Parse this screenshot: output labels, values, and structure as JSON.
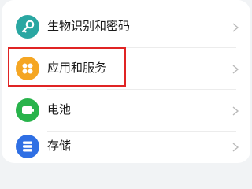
{
  "settings": {
    "items": [
      {
        "label": "生物识别和密码",
        "icon": "key-icon",
        "color": "#2aa7a2"
      },
      {
        "label": "应用和服务",
        "icon": "apps-grid-icon",
        "color": "#f5a623"
      },
      {
        "label": "电池",
        "icon": "battery-icon",
        "color": "#28b34b"
      },
      {
        "label": "存储",
        "icon": "storage-icon",
        "color": "#2f6fe4"
      }
    ],
    "highlight_color": "#e02424"
  }
}
